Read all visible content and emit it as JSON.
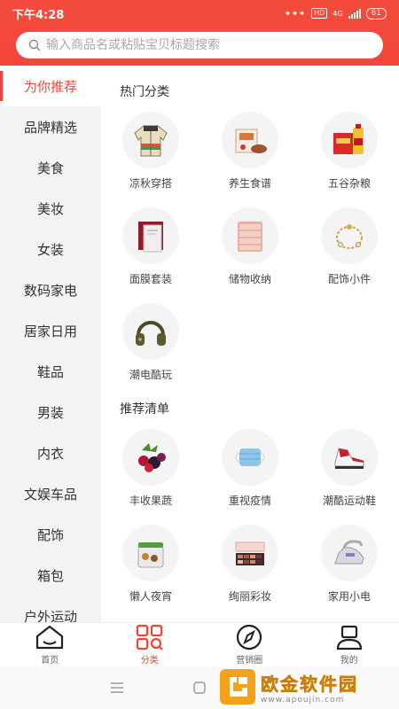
{
  "status_bar": {
    "time": "下午4:28",
    "dots": "•••",
    "hd": "HD",
    "network": "4G",
    "battery": "61"
  },
  "search": {
    "placeholder": "输入商品名或粘贴宝贝标题搜索"
  },
  "sidebar": {
    "items": [
      {
        "label": "为你推荐",
        "active": true
      },
      {
        "label": "品牌精选"
      },
      {
        "label": "美食"
      },
      {
        "label": "美妆"
      },
      {
        "label": "女装"
      },
      {
        "label": "数码家电"
      },
      {
        "label": "居家日用"
      },
      {
        "label": "鞋品"
      },
      {
        "label": "男装"
      },
      {
        "label": "内衣"
      },
      {
        "label": "文娱车品"
      },
      {
        "label": "配饰"
      },
      {
        "label": "箱包"
      },
      {
        "label": "户外运动"
      }
    ]
  },
  "sections": [
    {
      "title": "热门分类",
      "items": [
        {
          "label": "凉秋穿搭",
          "icon": "jacket-icon"
        },
        {
          "label": "养生食谱",
          "icon": "food-package-icon"
        },
        {
          "label": "五谷杂粮",
          "icon": "grain-oil-icon"
        },
        {
          "label": "面膜套装",
          "icon": "mask-box-icon"
        },
        {
          "label": "储物收纳",
          "icon": "drawer-cabinet-icon"
        },
        {
          "label": "配饰小件",
          "icon": "bracelet-icon"
        },
        {
          "label": "潮电酷玩",
          "icon": "headphones-icon"
        }
      ]
    },
    {
      "title": "推荐清单",
      "items": [
        {
          "label": "丰收果蔬",
          "icon": "berries-icon"
        },
        {
          "label": "重视疫情",
          "icon": "face-mask-icon"
        },
        {
          "label": "潮酷运动鞋",
          "icon": "sneaker-icon"
        },
        {
          "label": "懒人夜宵",
          "icon": "snack-box-icon"
        },
        {
          "label": "绚丽彩妆",
          "icon": "eyeshadow-palette-icon"
        },
        {
          "label": "家用小电",
          "icon": "steam-iron-icon"
        }
      ]
    }
  ],
  "tabbar": {
    "tabs": [
      {
        "label": "首页",
        "icon": "home-icon"
      },
      {
        "label": "分类",
        "icon": "category-icon",
        "active": true
      },
      {
        "label": "营销圈",
        "icon": "compass-icon"
      },
      {
        "label": "我的",
        "icon": "profile-icon"
      }
    ]
  },
  "watermark": {
    "title": "欧金软件园",
    "url": "www.apoujin.com"
  },
  "colors": {
    "brand": "#f44a3c",
    "accent": "#f14436",
    "sidebar_bg": "#f3f3f3"
  }
}
